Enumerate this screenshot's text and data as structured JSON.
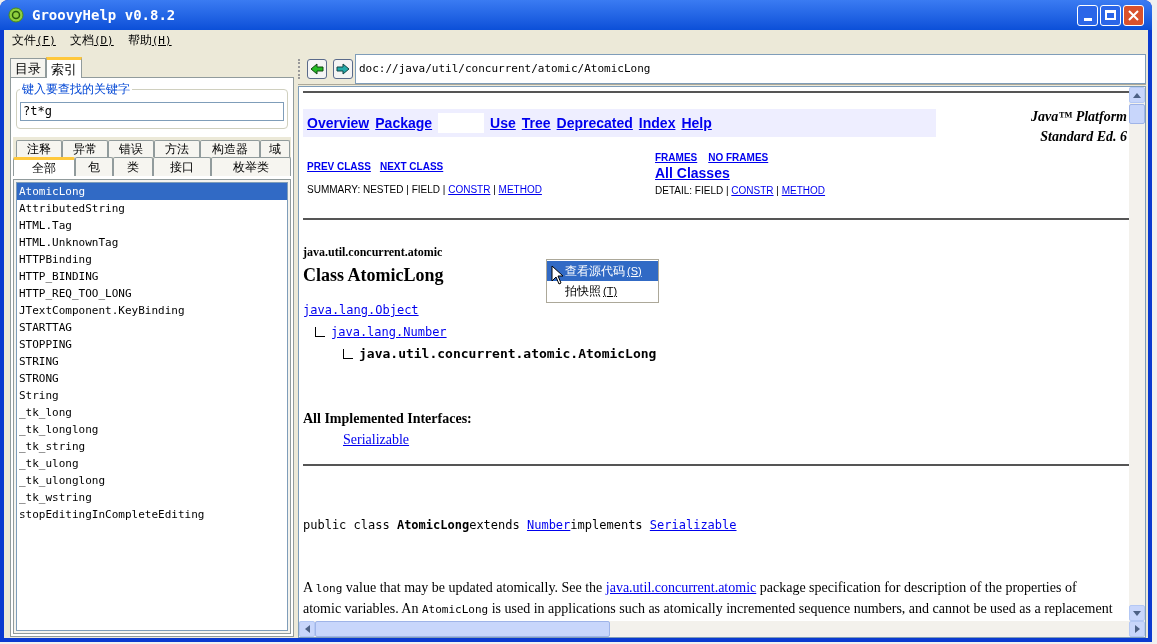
{
  "window": {
    "title": "GroovyHelp v0.8.2"
  },
  "menu": [
    {
      "label": "文件",
      "mnemonic": "(F)"
    },
    {
      "label": "文档",
      "mnemonic": "(D)"
    },
    {
      "label": "帮助",
      "mnemonic": "(H)"
    }
  ],
  "left_tabs": [
    {
      "label": "目录",
      "selected": false
    },
    {
      "label": "索引",
      "selected": true
    }
  ],
  "search": {
    "legend": "键入要查找的关键字",
    "value": "?t*g"
  },
  "filter_tabs_row_1": [
    {
      "label": "注释",
      "selected": false
    },
    {
      "label": "异常",
      "selected": false
    },
    {
      "label": "错误",
      "selected": false
    },
    {
      "label": "方法",
      "selected": false
    },
    {
      "label": "构造器",
      "selected": false
    },
    {
      "label": "域",
      "selected": false
    }
  ],
  "filter_tabs_row_2": [
    {
      "label": "全部",
      "selected": true
    },
    {
      "label": "包",
      "selected": false
    },
    {
      "label": "类",
      "selected": false
    },
    {
      "label": "接口",
      "selected": false
    },
    {
      "label": "枚举类",
      "selected": false
    }
  ],
  "index_list": [
    {
      "label": "AtomicLong",
      "selected": true
    },
    {
      "label": "AttributedString",
      "selected": false
    },
    {
      "label": "HTML.Tag",
      "selected": false
    },
    {
      "label": "HTML.UnknownTag",
      "selected": false
    },
    {
      "label": "HTTPBinding",
      "selected": false
    },
    {
      "label": "HTTP_BINDING",
      "selected": false
    },
    {
      "label": "HTTP_REQ_TOO_LONG",
      "selected": false
    },
    {
      "label": "JTextComponent.KeyBinding",
      "selected": false
    },
    {
      "label": "STARTTAG",
      "selected": false
    },
    {
      "label": "STOPPING",
      "selected": false
    },
    {
      "label": "STRING",
      "selected": false
    },
    {
      "label": "STRONG",
      "selected": false
    },
    {
      "label": "String",
      "selected": false
    },
    {
      "label": "_tk_long",
      "selected": false
    },
    {
      "label": "_tk_longlong",
      "selected": false
    },
    {
      "label": "_tk_string",
      "selected": false
    },
    {
      "label": "_tk_ulong",
      "selected": false
    },
    {
      "label": "_tk_ulonglong",
      "selected": false
    },
    {
      "label": "_tk_wstring",
      "selected": false
    },
    {
      "label": "stopEditingInCompleteEditing",
      "selected": false
    }
  ],
  "address": "doc://java/util/concurrent/atomic/AtomicLong",
  "doc": {
    "nav": [
      {
        "kind": "link",
        "label": "Overview"
      },
      {
        "kind": "link",
        "label": "Package"
      },
      {
        "kind": "blank"
      },
      {
        "kind": "link",
        "label": "Use"
      },
      {
        "kind": "link",
        "label": "Tree"
      },
      {
        "kind": "link",
        "label": "Deprecated"
      },
      {
        "kind": "link",
        "label": "Index"
      },
      {
        "kind": "link",
        "label": "Help"
      }
    ],
    "platform": [
      "Java™ Platform",
      "Standard Ed. 6"
    ],
    "class_links": [
      "PREV CLASS",
      "NEXT CLASS"
    ],
    "frame_links": [
      "FRAMES",
      "NO FRAMES"
    ],
    "all_classes": "All Classes",
    "summary": [
      {
        "kind": "text",
        "text": "SUMMARY: NESTED | FIELD | "
      },
      {
        "kind": "link",
        "text": "CONSTR"
      },
      {
        "kind": "text",
        "text": " | "
      },
      {
        "kind": "link",
        "text": "METHOD"
      }
    ],
    "detail": [
      {
        "kind": "text",
        "text": "DETAIL: FIELD | "
      },
      {
        "kind": "link",
        "text": "CONSTR"
      },
      {
        "kind": "text",
        "text": " | "
      },
      {
        "kind": "link",
        "text": "METHOD"
      }
    ],
    "package": "java.util.concurrent.atomic",
    "title": "Class AtomicLong",
    "hierarchy": [
      {
        "kind": "link",
        "text": "java.lang.Object",
        "children": [
          {
            "kind": "link",
            "text": "java.lang.Number",
            "children": [
              {
                "kind": "current",
                "text": "java.util.concurrent.atomic.AtomicLong"
              }
            ]
          }
        ]
      }
    ],
    "interfaces_heading": "All Implemented Interfaces:",
    "interfaces": [
      "Serializable"
    ],
    "declaration": [
      {
        "kind": "text",
        "text": "public class "
      },
      {
        "kind": "bold",
        "text": "AtomicLong"
      },
      {
        "kind": "text",
        "text": "extends "
      },
      {
        "kind": "link",
        "text": "Number"
      },
      {
        "kind": "text",
        "text": "implements "
      },
      {
        "kind": "link",
        "text": "Serializable"
      }
    ],
    "description": [
      {
        "kind": "text",
        "text": "A "
      },
      {
        "kind": "code",
        "text": "long"
      },
      {
        "kind": "text",
        "text": " value that may be updated atomically. See the "
      },
      {
        "kind": "link",
        "text": "java.util.concurrent.atomic"
      },
      {
        "kind": "text",
        "text": " package specification for description of the properties of atomic variables. An "
      },
      {
        "kind": "code",
        "text": "AtomicLong"
      },
      {
        "kind": "text",
        "text": " is used in applications such as atomically incremented sequence numbers, and cannot be used as a replacement"
      }
    ]
  },
  "context_menu": [
    {
      "label": "查看源代码",
      "mnemonic": "(S)",
      "selected": true
    },
    {
      "label": "拍快照",
      "mnemonic": "(T)",
      "selected": false
    }
  ]
}
